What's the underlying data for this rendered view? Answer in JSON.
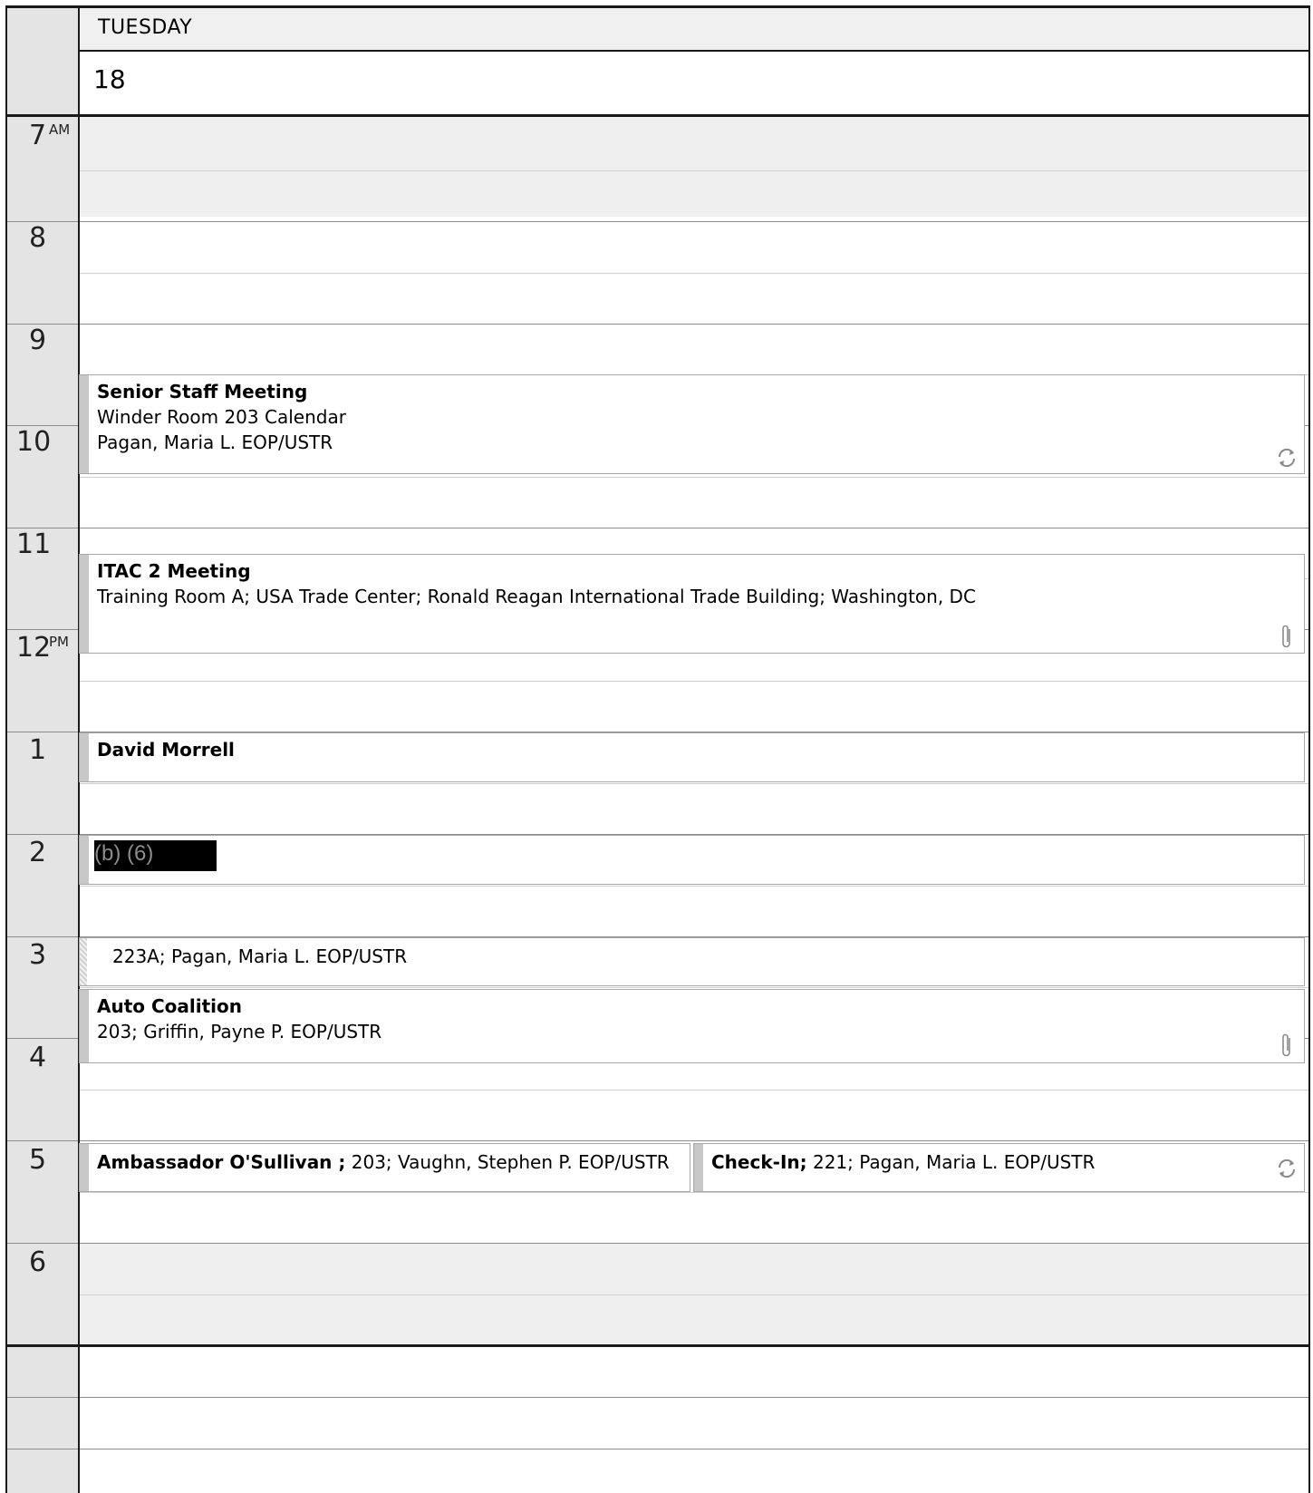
{
  "header": {
    "day_name": "TUESDAY",
    "day_number": "18"
  },
  "hours": [
    {
      "label": "7",
      "suffix": "AM"
    },
    {
      "label": "8",
      "suffix": ""
    },
    {
      "label": "9",
      "suffix": ""
    },
    {
      "label": "10",
      "suffix": ""
    },
    {
      "label": "11",
      "suffix": ""
    },
    {
      "label": "12",
      "suffix": "PM"
    },
    {
      "label": "1",
      "suffix": ""
    },
    {
      "label": "2",
      "suffix": ""
    },
    {
      "label": "3",
      "suffix": ""
    },
    {
      "label": "4",
      "suffix": ""
    },
    {
      "label": "5",
      "suffix": ""
    },
    {
      "label": "6",
      "suffix": ""
    }
  ],
  "events": {
    "senior_staff": {
      "title": "Senior Staff Meeting",
      "location": "Winder Room 203 Calendar",
      "organizer": "Pagan, Maria L. EOP/USTR",
      "icon": "recurring-icon"
    },
    "itac": {
      "title": "ITAC 2 Meeting",
      "location": "Training Room A; USA Trade Center; Ronald Reagan International Trade Building; Washington, DC",
      "icon": "attachment-icon"
    },
    "david": {
      "title": "David Morrell"
    },
    "redacted": {
      "text": "(b) (6)"
    },
    "room_223a": {
      "text": "223A; Pagan, Maria L. EOP/USTR"
    },
    "auto": {
      "title": "Auto Coalition",
      "details": "203; Griffin, Payne P. EOP/USTR",
      "icon": "attachment-icon"
    },
    "osullivan": {
      "title": "Ambassador O'Sullivan ;",
      "details": " 203; Vaughn, Stephen P. EOP/USTR"
    },
    "checkin": {
      "title": "Check-In;",
      "details": " 221; Pagan, Maria L. EOP/USTR",
      "icon": "recurring-icon"
    }
  },
  "colors": {
    "gutter": "#e4e4e4",
    "off_hours": "#efefef",
    "event_bar": "#c8c8c8",
    "redaction": "#000000"
  }
}
